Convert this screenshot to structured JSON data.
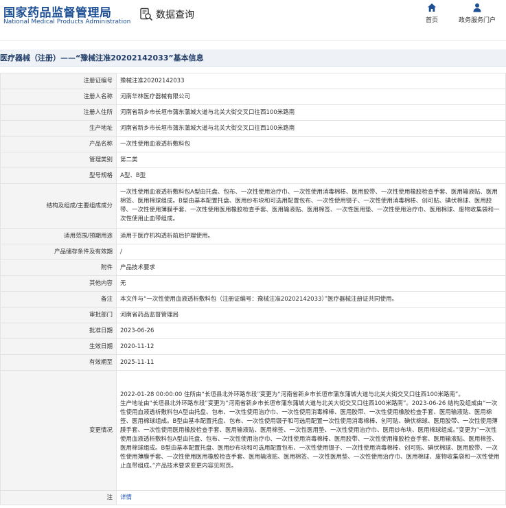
{
  "header": {
    "logo_cn": "国家药品监督管理局",
    "logo_en": "National Medical Products Administration",
    "query_label": "数据查询",
    "nav": [
      {
        "label": "首页",
        "icon": "home-icon"
      },
      {
        "label": "政务服务门户",
        "icon": "user-icon"
      }
    ]
  },
  "page_title": "医疗器械（注册）——“豫械注准20202142033”基本信息",
  "rows": [
    {
      "label": "注册证编号",
      "value": "豫械注准20202142033"
    },
    {
      "label": "注册人名称",
      "value": "河南华林医疗器械有限公司"
    },
    {
      "label": "注册人住所",
      "value": "河南省新乡市长垣市蒲东蒲城大道与北关大街交叉口往西100米路南"
    },
    {
      "label": "生产地址",
      "value": "河南省新乡市长垣市蒲东蒲城大道与北关大街交叉口往西100米路南"
    },
    {
      "label": "产品名称",
      "value": "一次性使用血液透析敷料包"
    },
    {
      "label": "管理类别",
      "value": "第二类"
    },
    {
      "label": "型号规格",
      "value": "A型、B型"
    },
    {
      "label": "结构及组成/主要组成成分",
      "value": "一次性使用血液透析敷料包A型由托盘、包布、一次性使用治疗巾、一次性使用消毒棉棒、医用胶带、一次性使用橡胶检查手套、医用输液贴、医用棉签、医用棉球组成。B型由基本配置托盘、医用纱布块和可选用配置包布、一次性使用镊子、一次性使用消毒棉棒、创可贴、碘伏棉球、医用胶带、一次性使用薄膜手套、一次性使用医用橡胶检查手套、医用输液贴、医用棉签、一次性医用垫、一次性使用治疗巾、医用棉球、废物收集袋和一次性使用止血带组成。"
    },
    {
      "label": "适用范围/预期用途",
      "value": "适用于医疗机构透析前后护理使用。"
    },
    {
      "label": "产品储存条件及有效期",
      "value": "/"
    },
    {
      "label": "附件",
      "value": "产品技术要求"
    },
    {
      "label": "其他内容",
      "value": "无"
    },
    {
      "label": "备注",
      "value": "本文件与“一次性使用血液透析敷料包（注册证编号：豫械注准20202142033）”医疗器械注册证共同使用。"
    },
    {
      "label": "审批部门",
      "value": "河南省药品监督管理局"
    },
    {
      "label": "批准日期",
      "value": "2023-06-26"
    },
    {
      "label": "生效日期",
      "value": "2020-11-12"
    },
    {
      "label": "有效期至",
      "value": "2025-11-11"
    },
    {
      "label": "变更情况",
      "value": "2022-01-28 00:00:00 住所由“长垣县北外环路东段”变更为“河南省新乡市长垣市蒲东蒲城大道与北关大街交叉口往西100米路南”。\n生产地址由“长垣县北外环路东段”变更为“河南省新乡市长垣市蒲东蒲城大道与北关大街交叉口往西100米路南”。2023-06-26 结构及组成由“一次性使用血液透析敷料包A型由托盘、包布、一次性使用治疗巾、一次性使用消毒棉棒、医用胶带、一次性使用橡胶检查手套、医用输液贴、医用棉签、医用棉球组成。B型由基本配置托盘、包布、一次性使用镊子和可选用配置一次性使用消毒棉棒、创可贴、碘伏棉球、医用胶带、一次性使用薄膜手套、一次性使用医用橡胶检查手套、医用输液贴、医用棉签、一次性医用垫、一次性使用治疗巾、医用纱布块、医用棉球组成。”变更为“一次性使用血液透析敷料包A型由托盘、包布、一次性使用治疗巾、一次性使用消毒棉棒、医用胶带、一次性使用橡胶检查手套、医用输液贴、医用棉签、医用棉球组成。B型由基本配置托盘、医用纱布块和可选用配置包布、一次性使用镊子、一次性使用消毒棉棒、创可贴、碘伏棉球、医用胶带、一次性使用薄膜手套、一次性使用医用橡胶检查手套、医用输液贴、医用棉签、一次性医用垫、一次性使用治疗巾、医用棉球、废物收集袋和一次性使用止血带组成。”产品技术要求变更内容见附页。"
    },
    {
      "label": "注",
      "value": "详情"
    }
  ]
}
